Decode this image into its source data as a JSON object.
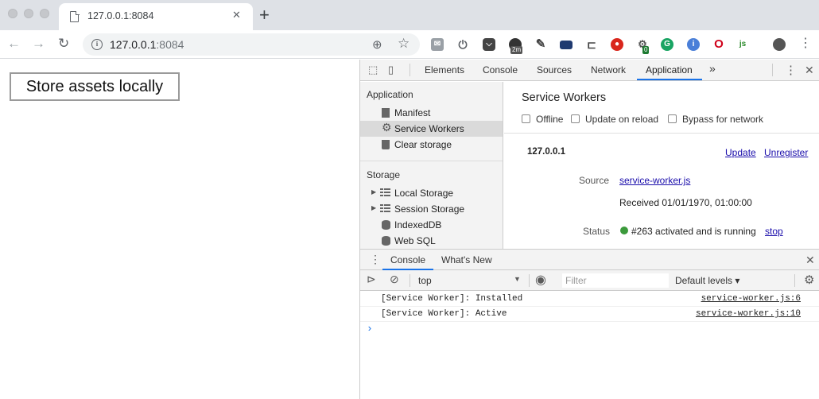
{
  "browser": {
    "tab_title": "127.0.0.1:8084",
    "tab_close": "✕",
    "new_tab": "+",
    "url_host": "127.0.0.1",
    "url_port": ":8084",
    "nav_back": "←",
    "nav_forward": "→",
    "nav_reload": "↻",
    "ext_badge_1": "2m",
    "ext_badge_2": "0"
  },
  "page": {
    "store_button_label": "Store assets locally"
  },
  "devtools": {
    "tabs": [
      "Elements",
      "Console",
      "Sources",
      "Network",
      "Application"
    ],
    "more_tabs": "»",
    "active_tab": "Application",
    "sidebar": {
      "section_application": "Application",
      "items_application": [
        "Manifest",
        "Service Workers",
        "Clear storage"
      ],
      "section_storage": "Storage",
      "items_storage": [
        "Local Storage",
        "Session Storage",
        "IndexedDB",
        "Web SQL"
      ]
    },
    "service_workers": {
      "title": "Service Workers",
      "options": [
        "Offline",
        "Update on reload",
        "Bypass for network"
      ],
      "origin": "127.0.0.1",
      "update_link": "Update",
      "unregister_link": "Unregister",
      "source_label": "Source",
      "source_file": "service-worker.js",
      "received": "Received 01/01/1970, 01:00:00",
      "status_label": "Status",
      "status_text": "#263 activated and is running",
      "stop_link": "stop",
      "status_color": "#3c9a3c"
    },
    "drawer": {
      "tabs": [
        "Console",
        "What's New"
      ],
      "context": "top",
      "filter_placeholder": "Filter",
      "levels": "Default levels ▾",
      "messages": [
        {
          "text": "[Service Worker]: Installed",
          "source": "service-worker.js:6"
        },
        {
          "text": "[Service Worker]: Active",
          "source": "service-worker.js:10"
        }
      ],
      "prompt": "›"
    },
    "accent_color": "#1a73e8"
  }
}
